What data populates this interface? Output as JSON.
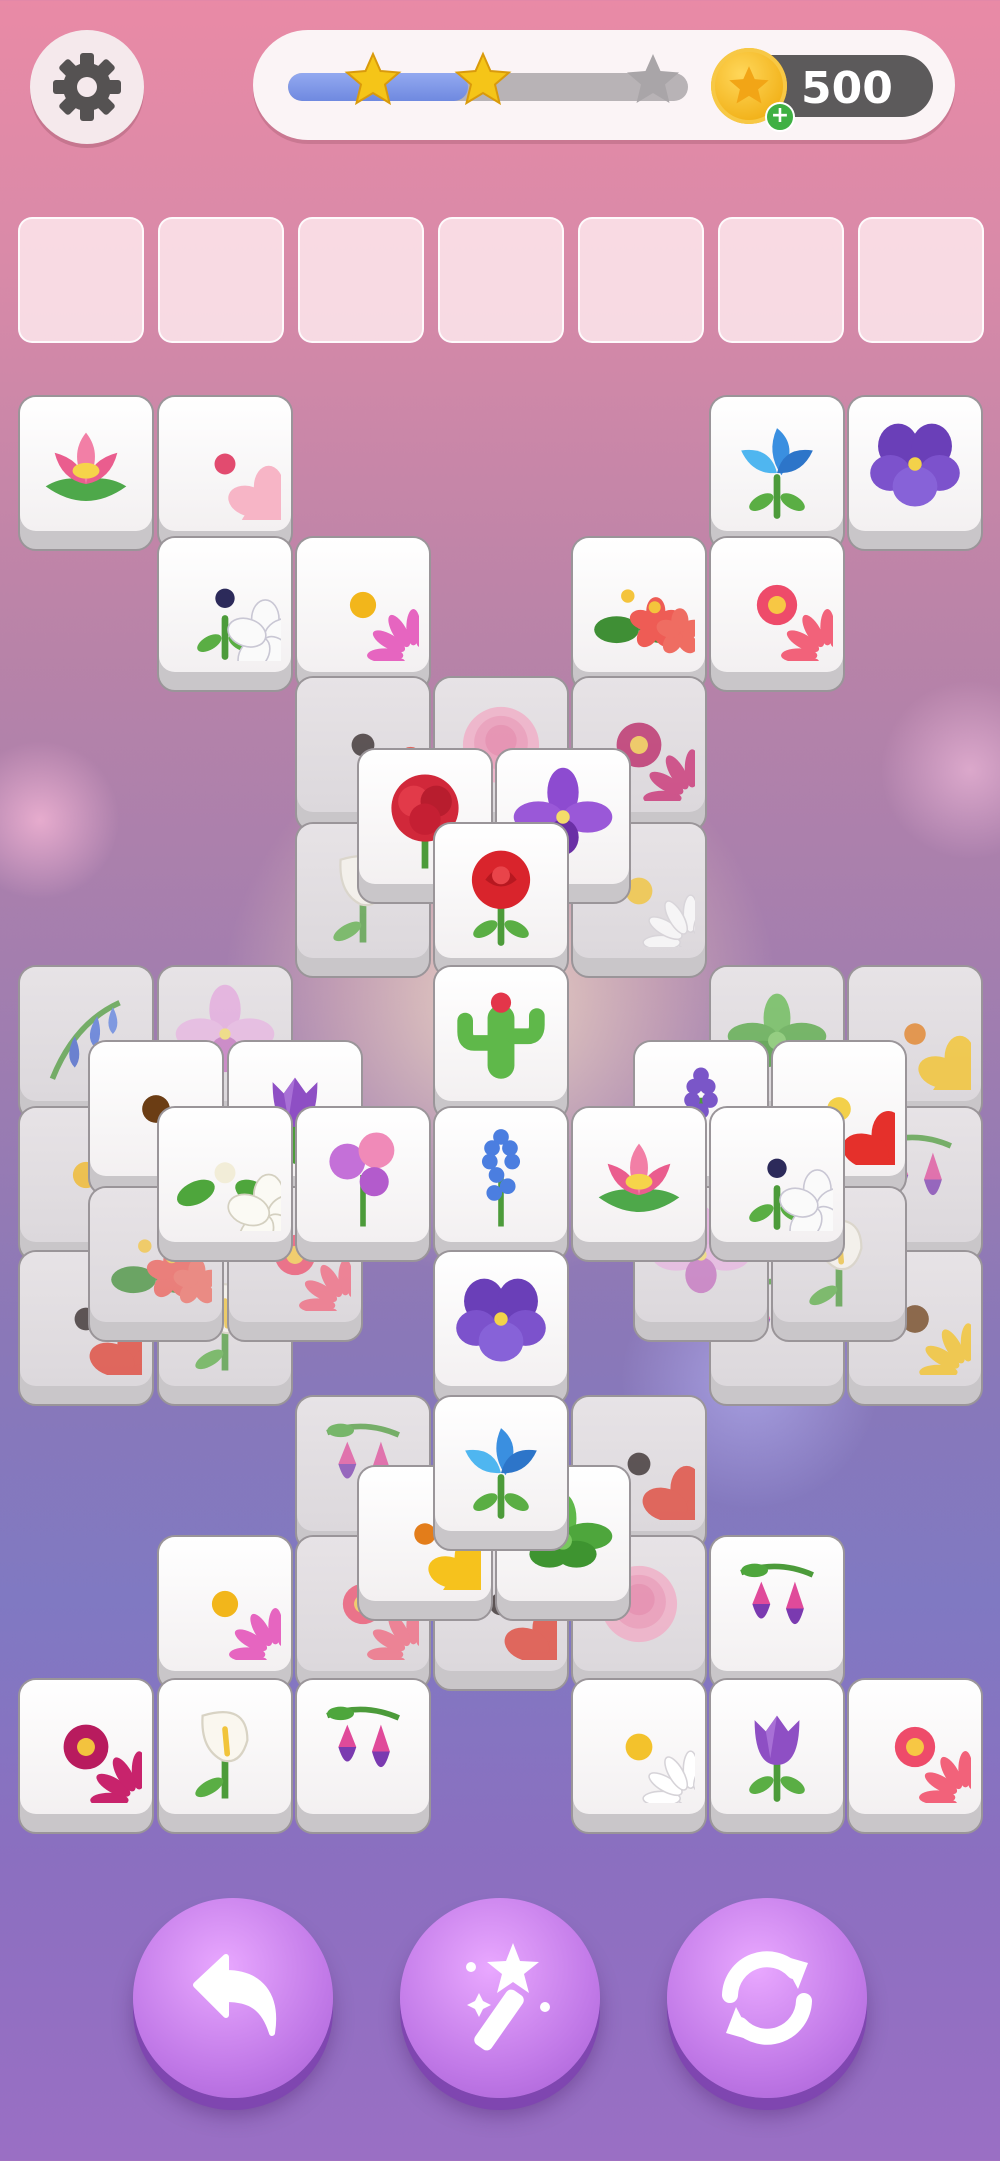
{
  "hud": {
    "settings_icon": "gear-icon",
    "progress": {
      "fill_fraction": 0.45,
      "stars_earned": 2,
      "stars_total": 3
    },
    "coins": {
      "count": "500",
      "icon": "coin-icon",
      "add_icon": "plus-icon"
    }
  },
  "tray": {
    "slots_total": 7,
    "slots_filled": 0
  },
  "board": {
    "tiles_visible": [
      "lotus",
      "cherry-blossom",
      "blue-iris",
      "purple-pansy",
      "white-anemone",
      "pink-daisy",
      "begonia",
      "zinnia",
      "poppy",
      "peony",
      "dahlia",
      "red-carnation",
      "purple-orchid",
      "calla-lily",
      "red-rose",
      "daisy",
      "bluebell",
      "orchid",
      "cactus",
      "green-succulent",
      "yellow-lily",
      "sunflower",
      "tulip",
      "lavender",
      "hibiscus",
      "gardenia",
      "sweet-pea",
      "blue-hyacinth",
      "lotus",
      "white-anemone",
      "fuchsia",
      "purple-pansy",
      "blue-iris",
      "poppy",
      "dahlia",
      "calla-lily",
      "fuchsia",
      "daisy",
      "tulip",
      "zinnia"
    ]
  },
  "controls": {
    "undo_icon": "undo-icon",
    "magic_icon": "magic-wand-icon",
    "shuffle_icon": "shuffle-icon"
  },
  "colors": {
    "accent": "#c27ae8",
    "progress": "#6f89e0",
    "star": "#f5c518"
  }
}
